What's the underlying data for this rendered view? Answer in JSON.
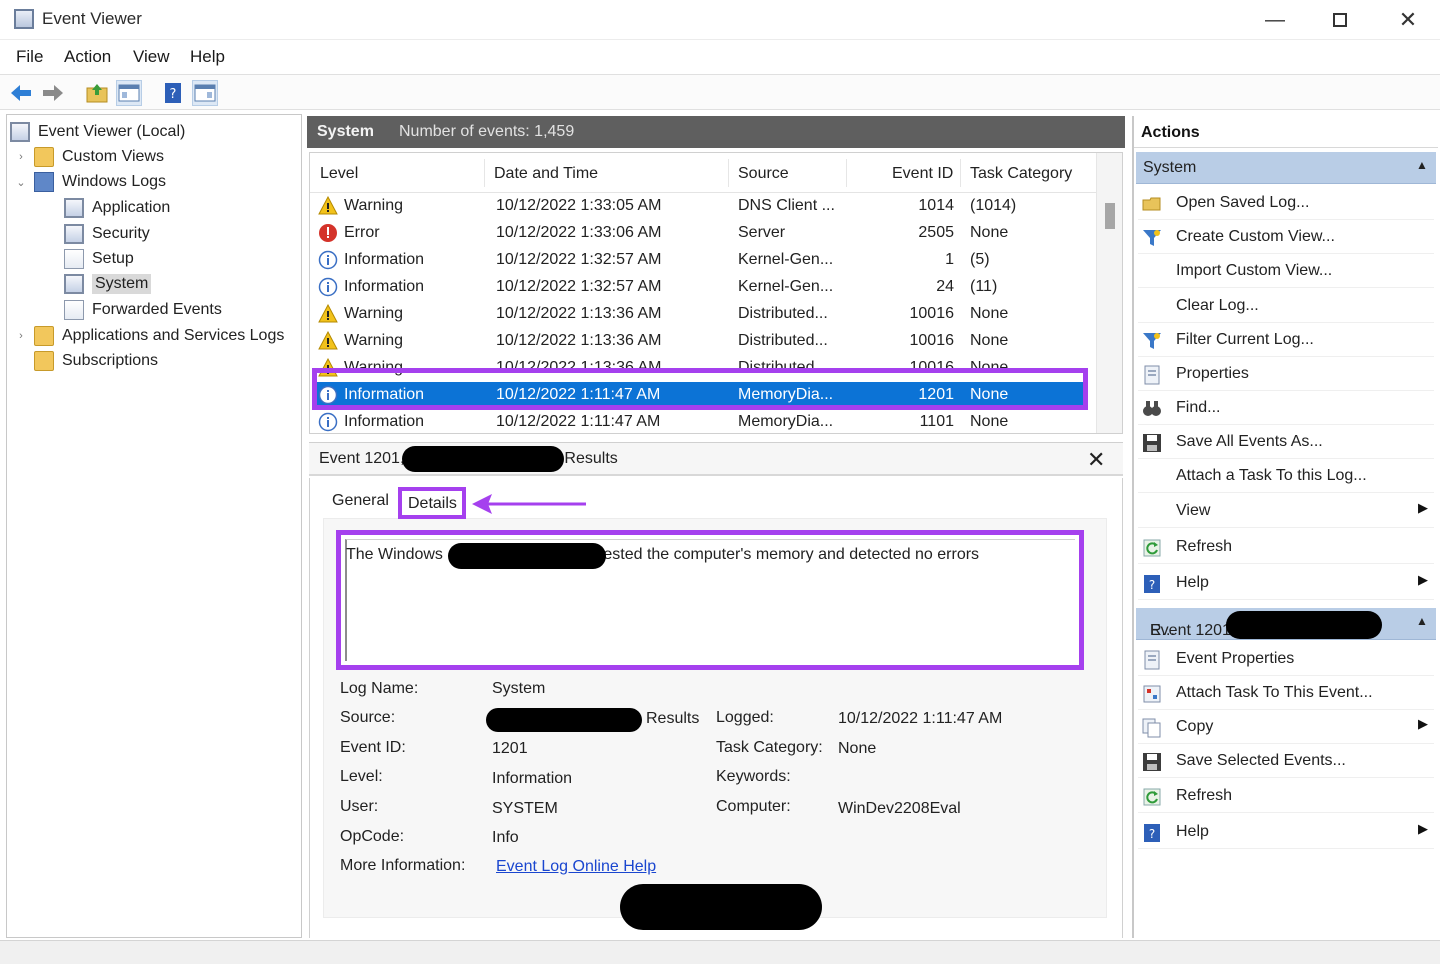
{
  "window": {
    "title": "Event Viewer",
    "minimize": "—",
    "close": "✕"
  },
  "menu": [
    "File",
    "Action",
    "View",
    "Help"
  ],
  "tree": {
    "root": "Event Viewer (Local)",
    "custom_views": "Custom Views",
    "windows_logs": "Windows Logs",
    "application": "Application",
    "security": "Security",
    "setup": "Setup",
    "system": "System",
    "forwarded": "Forwarded Events",
    "app_services": "Applications and Services Logs",
    "subscriptions": "Subscriptions"
  },
  "center_header": {
    "log": "System",
    "count": "Number of events: 1,459"
  },
  "grid": {
    "columns": [
      "Level",
      "Date and Time",
      "Source",
      "Event ID",
      "Task Category"
    ],
    "rows": [
      {
        "level": "Warning",
        "icon": "warning-icon",
        "date": "10/12/2022 1:33:05 AM",
        "source": "DNS Client ...",
        "id": "1014",
        "task": "(1014)"
      },
      {
        "level": "Error",
        "icon": "error-icon",
        "date": "10/12/2022 1:33:06 AM",
        "source": "Server",
        "id": "2505",
        "task": "None"
      },
      {
        "level": "Information",
        "icon": "info-icon",
        "date": "10/12/2022 1:32:57 AM",
        "source": "Kernel-Gen...",
        "id": "1",
        "task": "(5)"
      },
      {
        "level": "Information",
        "icon": "info-icon",
        "date": "10/12/2022 1:32:57 AM",
        "source": "Kernel-Gen...",
        "id": "24",
        "task": "(11)"
      },
      {
        "level": "Warning",
        "icon": "warning-icon",
        "date": "10/12/2022 1:13:36 AM",
        "source": "Distributed...",
        "id": "10016",
        "task": "None"
      },
      {
        "level": "Warning",
        "icon": "warning-icon",
        "date": "10/12/2022 1:13:36 AM",
        "source": "Distributed...",
        "id": "10016",
        "task": "None"
      },
      {
        "level": "Warning",
        "icon": "warning-icon",
        "date": "10/12/2022 1:13:36 AM",
        "source": "Distributed...",
        "id": "10016",
        "task": "None"
      },
      {
        "level": "Information",
        "icon": "info-icon",
        "date": "10/12/2022 1:11:47 AM",
        "source": "MemoryDia...",
        "id": "1201",
        "task": "None"
      },
      {
        "level": "Information",
        "icon": "info-icon",
        "date": "10/12/2022 1:11:47 AM",
        "source": "MemoryDia...",
        "id": "1101",
        "task": "None"
      }
    ]
  },
  "detail": {
    "header_prefix": "Event 1201,",
    "header_suffix": "Results",
    "tab_general": "General",
    "tab_details": "Details",
    "desc_prefix": "The Windows",
    "desc_suffix": "tested the computer's memory and detected no errors",
    "labels": {
      "log_name": "Log Name:",
      "source": "Source:",
      "event_id": "Event ID:",
      "level": "Level:",
      "user": "User:",
      "opcode": "OpCode:",
      "more_info": "More Information:",
      "logged": "Logged:",
      "task_category": "Task Category:",
      "keywords": "Keywords:",
      "computer": "Computer:"
    },
    "values": {
      "log_name": "System",
      "source_suffix": "Results",
      "event_id": "1201",
      "level": "Information",
      "user": "SYSTEM",
      "opcode": "Info",
      "more_info_link": "Event Log Online Help",
      "logged": "10/12/2022 1:11:47 AM",
      "task_category": "None",
      "keywords": "",
      "computer": "WinDev2208Eval"
    }
  },
  "actions": {
    "title": "Actions",
    "section1": "System",
    "items1": [
      {
        "label": "Open Saved Log...",
        "icon": "folder-open-icon",
        "sub": false
      },
      {
        "label": "Create Custom View...",
        "icon": "filter-icon",
        "sub": false
      },
      {
        "label": "Import Custom View...",
        "icon": "",
        "sub": false
      },
      {
        "label": "Clear Log...",
        "icon": "",
        "sub": false
      },
      {
        "label": "Filter Current Log...",
        "icon": "filter-icon",
        "sub": false
      },
      {
        "label": "Properties",
        "icon": "properties-icon",
        "sub": false
      },
      {
        "label": "Find...",
        "icon": "binoculars-icon",
        "sub": false
      },
      {
        "label": "Save All Events As...",
        "icon": "save-icon",
        "sub": false
      },
      {
        "label": "Attach a Task To this Log...",
        "icon": "",
        "sub": false
      },
      {
        "label": "View",
        "icon": "",
        "sub": true
      },
      {
        "label": "Refresh",
        "icon": "refresh-icon",
        "sub": false
      },
      {
        "label": "Help",
        "icon": "help-icon",
        "sub": true
      }
    ],
    "section2_prefix": "Event 1201,",
    "section2_suffix": "R...",
    "items2": [
      {
        "label": "Event Properties",
        "icon": "properties-icon",
        "sub": false
      },
      {
        "label": "Attach Task To This Event...",
        "icon": "task-icon",
        "sub": false
      },
      {
        "label": "Copy",
        "icon": "copy-icon",
        "sub": true
      },
      {
        "label": "Save Selected Events...",
        "icon": "save-icon",
        "sub": false
      },
      {
        "label": "Refresh",
        "icon": "refresh-icon",
        "sub": false
      },
      {
        "label": "Help",
        "icon": "help-icon",
        "sub": true
      }
    ]
  },
  "colors": {
    "selection": "#0c73d6",
    "annotation": "#a540ee",
    "section_header": "#b9cde6",
    "link": "#1a46cf"
  }
}
